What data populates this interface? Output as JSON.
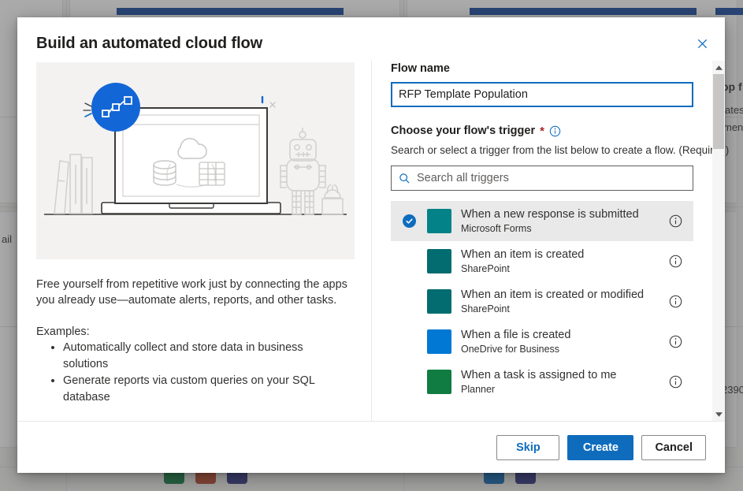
{
  "dialog": {
    "title": "Build an automated cloud flow",
    "close_label": "Close",
    "illustration_alt": "automation-illustration"
  },
  "left_panel": {
    "description": "Free yourself from repetitive work just by connecting the apps you already use—automate alerts, reports, and other tasks.",
    "examples_label": "Examples:",
    "examples": [
      "Automatically collect and store data in business solutions",
      "Generate reports via custom queries on your SQL database"
    ]
  },
  "right_panel": {
    "flow_name_label": "Flow name",
    "flow_name_value": "RFP Template Population",
    "flow_name_placeholder": "Flow name",
    "trigger_label": "Choose your flow's trigger",
    "required_marker": "*",
    "trigger_help": "Search or select a trigger from the list below to create a flow. (Required)",
    "search_placeholder": "Search all triggers",
    "search_value": "",
    "triggers": [
      {
        "title": "When a new response is submitted",
        "connector": "Microsoft Forms",
        "color": "#038387",
        "selected": true
      },
      {
        "title": "When an item is created",
        "connector": "SharePoint",
        "color": "#036c70",
        "selected": false
      },
      {
        "title": "When an item is created or modified",
        "connector": "SharePoint",
        "color": "#036c70",
        "selected": false
      },
      {
        "title": "When a file is created",
        "connector": "OneDrive for Business",
        "color": "#0078d4",
        "selected": false
      },
      {
        "title": "When a task is assigned to me",
        "connector": "Planner",
        "color": "#107c41",
        "selected": false
      }
    ]
  },
  "footer": {
    "skip_label": "Skip",
    "create_label": "Create",
    "cancel_label": "Cancel"
  },
  "background": {
    "left_fragment": "ail",
    "right_fragments": [
      "op f",
      "ates",
      "men"
    ],
    "right_number": "2390"
  },
  "colors": {
    "accent": "#0f6cbd",
    "primary_button": "#0f6cbd",
    "required": "#a4262c",
    "selected_row": "#e9e9e9",
    "illustration_bg": "#f3f2f1",
    "bg_card_bar": "#12449c"
  }
}
